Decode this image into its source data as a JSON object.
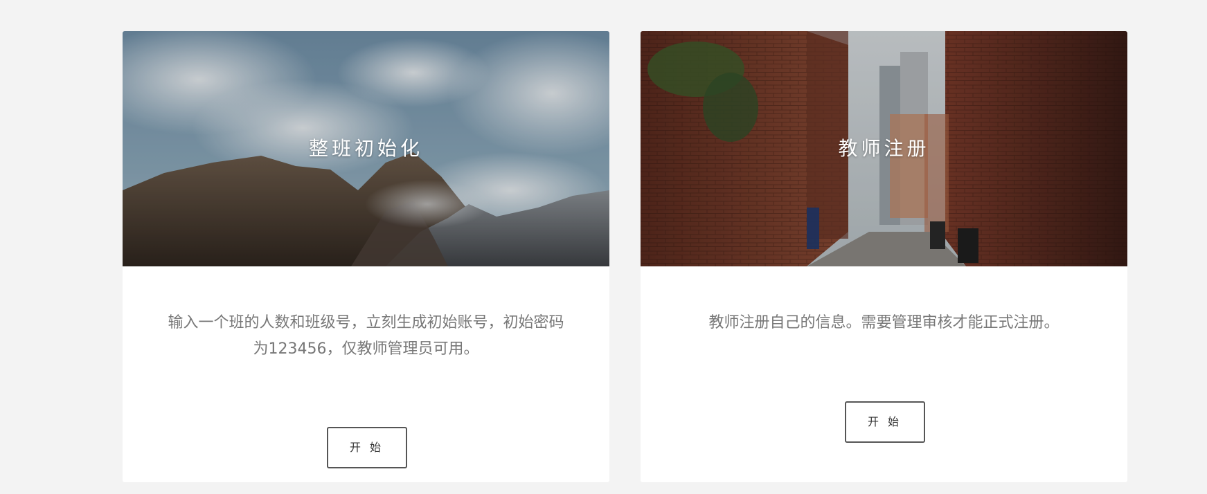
{
  "cards": [
    {
      "title": "整班初始化",
      "description": "输入一个班的人数和班级号，立刻生成初始账号，初始密码为123456，仅教师管理员可用。",
      "button_label": "开 始",
      "image": "mountain-sky-photo"
    },
    {
      "title": "教师注册",
      "description": "教师注册自己的信息。需要管理审核才能正式注册。",
      "button_label": "开 始",
      "image": "brick-alley-photo"
    }
  ]
}
